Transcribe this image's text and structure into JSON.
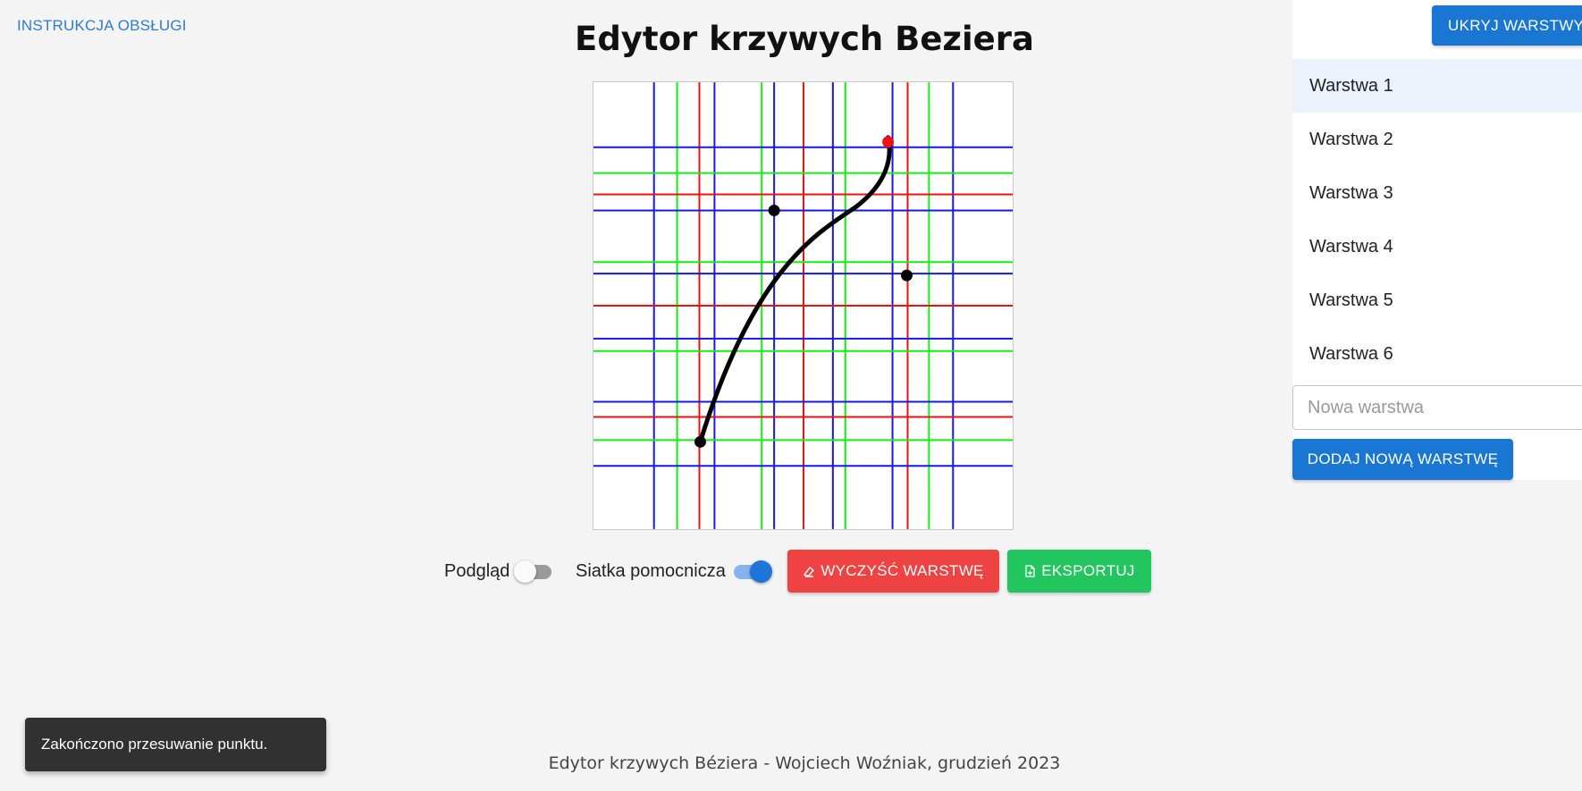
{
  "header": {
    "manual_link": "INSTRUKCJA OBSŁUGI",
    "title": "Edytor krzywych Beziera"
  },
  "canvas": {
    "grid_colors": {
      "red": "#ee1111",
      "green": "#14ee14",
      "blue": "#1717e6"
    },
    "curve_color": "#000000",
    "active_point_color": "#ee1111",
    "control_point_color": "#000000"
  },
  "controls": {
    "preview_label": "Podgląd",
    "preview_on": false,
    "grid_label": "Siatka pomocnicza",
    "grid_on": true,
    "clear_button": "WYCZYŚĆ WARSTWĘ",
    "clear_icon": "eraser-icon",
    "export_button": "EKSPORTUJ",
    "export_icon": "file-export-icon"
  },
  "panel": {
    "hide_button": "UKRYJ WARSTWY",
    "layers": [
      {
        "label": "Warstwa 1",
        "active": true
      },
      {
        "label": "Warstwa 2",
        "active": false
      },
      {
        "label": "Warstwa 3",
        "active": false
      },
      {
        "label": "Warstwa 4",
        "active": false
      },
      {
        "label": "Warstwa 5",
        "active": false
      },
      {
        "label": "Warstwa 6",
        "active": false
      }
    ],
    "new_layer_placeholder": "Nowa warstwa",
    "new_layer_value": "",
    "add_button": "DODAJ NOWĄ WARSTWĘ"
  },
  "toast": "Zakończono przesuwanie punktu.",
  "footer": "Edytor krzywych Béziera - Wojciech Woźniak, grudzień 2023",
  "colors": {
    "accent_blue": "#1976d2",
    "danger_red": "#ef4343",
    "success_green": "#22c55e"
  }
}
